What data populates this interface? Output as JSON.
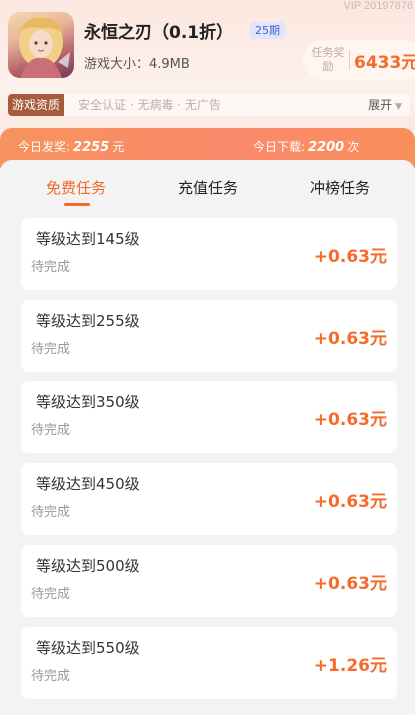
{
  "header": {
    "vip_text": "VIP 20197876",
    "game_title": "永恒之刃（0.1折）",
    "period_badge": "25期",
    "game_size": "游戏大小：4.9MB",
    "reward_label": "任务奖励",
    "reward_value": "6433元"
  },
  "qualification": {
    "tag": "游戏资质",
    "text": "安全认证 · 无病毒 · 无广告",
    "expand_label": "展开"
  },
  "stats": {
    "today_reward_label": "今日发奖:",
    "today_reward_value": "2255",
    "today_reward_unit": "元",
    "today_download_label": "今日下载:",
    "today_download_value": "2200",
    "today_download_unit": "次"
  },
  "tabs": [
    {
      "label": "免费任务",
      "active": true
    },
    {
      "label": "充值任务",
      "active": false
    },
    {
      "label": "冲榜任务",
      "active": false
    }
  ],
  "tasks": [
    {
      "name": "等级达到145级",
      "status": "待完成",
      "reward": "+0.63元"
    },
    {
      "name": "等级达到255级",
      "status": "待完成",
      "reward": "+0.63元"
    },
    {
      "name": "等级达到350级",
      "status": "待完成",
      "reward": "+0.63元"
    },
    {
      "name": "等级达到450级",
      "status": "待完成",
      "reward": "+0.63元"
    },
    {
      "name": "等级达到500级",
      "status": "待完成",
      "reward": "+0.63元"
    },
    {
      "name": "等级达到550级",
      "status": "待完成",
      "reward": "+1.26元"
    }
  ],
  "colors": {
    "accent": "#f06a2a",
    "stats_bar": "#f98f5a",
    "badge_bg": "#dfe6fb"
  }
}
